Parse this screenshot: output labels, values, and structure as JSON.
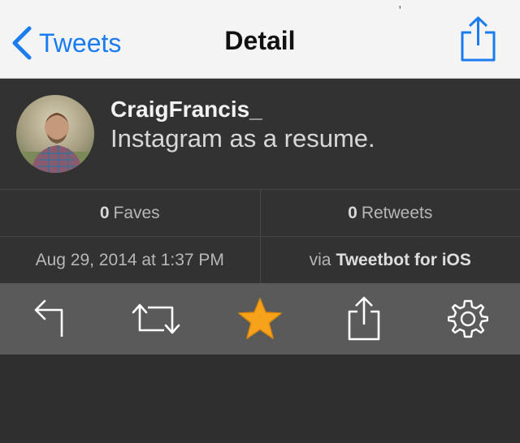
{
  "nav": {
    "back_label": "Tweets",
    "title": "Detail",
    "status_fragment": ","
  },
  "tweet": {
    "username": "CraigFrancis_",
    "text": "Instagram as a resume."
  },
  "stats": {
    "faves_count": "0",
    "faves_label": "Faves",
    "retweets_count": "0",
    "retweets_label": "Retweets"
  },
  "meta": {
    "timestamp": "Aug 29, 2014 at 1:37 PM",
    "via_prefix": "via",
    "via_app": "Tweetbot for iOS"
  },
  "toolbar": {
    "items": [
      {
        "icon": "reply-icon"
      },
      {
        "icon": "retweet-icon"
      },
      {
        "icon": "favorite-star-icon"
      },
      {
        "icon": "share-icon"
      },
      {
        "icon": "gear-icon"
      }
    ]
  },
  "colors": {
    "accent": "#1a7cf0",
    "star": "#f7a21b",
    "toolbar_bg": "#5a5a5a",
    "body_bg": "#2f2f2f"
  }
}
